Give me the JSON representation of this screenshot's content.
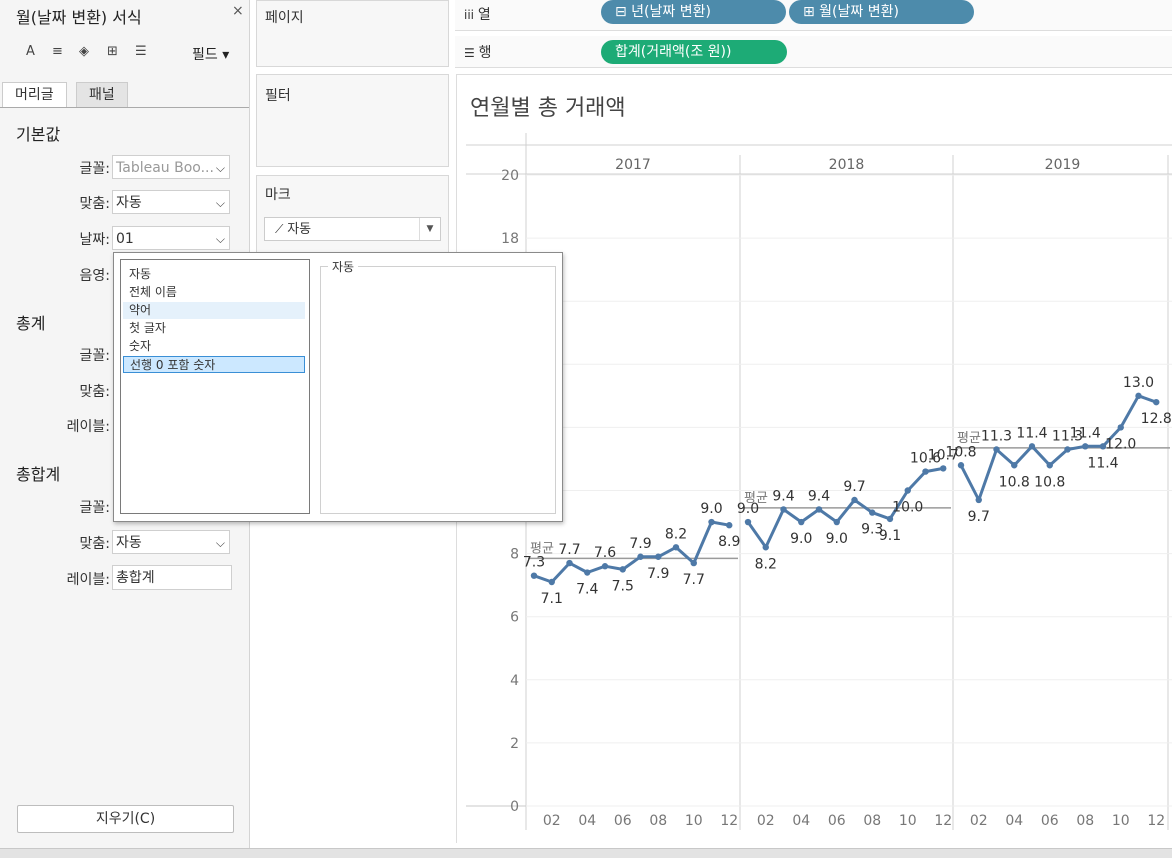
{
  "format_pane": {
    "title": "월(날짜 변환) 서식",
    "close_icon": "×",
    "toolbar": {
      "font_icon": "A",
      "align_icon": "≡",
      "shading_icon": "◈",
      "borders_icon": "⊞",
      "lines_icon": "☰",
      "fields_label": "필드 ▾"
    },
    "tabs": [
      "머리글",
      "패널"
    ],
    "default": {
      "heading": "기본값",
      "font_label": "글꼴:",
      "font_value": "Tableau Boo...",
      "align_label": "맞춤:",
      "align_value": "자동",
      "date_label": "날짜:",
      "date_value": "01",
      "shading_label": "음영:"
    },
    "totals": {
      "heading": "총계",
      "font_label": "글꼴:",
      "align_label": "맞춤:",
      "label_label": "레이블:"
    },
    "grand_totals": {
      "heading": "총합계",
      "font_label": "글꼴:",
      "align_label": "맞춤:",
      "align_value": "자동",
      "label_label": "레이블:",
      "label_value": "총합계"
    },
    "clear_button": "지우기(C)"
  },
  "shelves": {
    "pages": "페이지",
    "filters": "필터",
    "marks": "마크",
    "marks_type": "자동",
    "columns_label": "열",
    "rows_label": "행",
    "column_pills": [
      "⊟ 년(날짜 변환)",
      "⊞ 월(날짜 변환)"
    ],
    "row_pill": "합계(거래액(조 원))"
  },
  "popup": {
    "options": [
      "자동",
      "전체 이름",
      "약어",
      "첫 글자",
      "숫자",
      "선행 0 포함 숫자"
    ],
    "hover_index": 2,
    "selected_index": 5,
    "preview_label": "자동"
  },
  "colors": {
    "line": "#4e79a7",
    "pill_blue": "#4d8bab",
    "pill_green": "#1dab76",
    "popup_selected": "#cce8ff",
    "popup_hover": "#e5f1fb"
  },
  "chart_data": {
    "type": "line",
    "title": "연월별 총 거래액",
    "year_headers": [
      "2017",
      "2018",
      "2019"
    ],
    "month_ticks": [
      "02",
      "04",
      "06",
      "08",
      "10",
      "12"
    ],
    "y_ticks": [
      "0",
      "2",
      "4",
      "6",
      "8",
      "18",
      "20"
    ],
    "ylim": [
      0,
      20
    ],
    "reference_label": "평균",
    "series": [
      {
        "year": "2017",
        "values": [
          7.3,
          7.1,
          7.7,
          7.4,
          7.6,
          7.5,
          7.9,
          7.9,
          8.2,
          7.7,
          9.0,
          8.9
        ],
        "labels": [
          "7.3",
          "7.1",
          "7.7",
          "7.4",
          "7.6",
          "7.5",
          "7.9",
          "7.9",
          "8.2",
          "7.7",
          "9.0",
          "8.9"
        ],
        "average": 7.85
      },
      {
        "year": "2018",
        "values": [
          9.0,
          8.2,
          9.4,
          9.0,
          9.4,
          9.0,
          9.7,
          9.3,
          9.1,
          10.0,
          10.6,
          10.7
        ],
        "labels": [
          "9.0",
          "8.2",
          "9.4",
          "9.0",
          "9.4",
          "9.0",
          "9.7",
          "9.3",
          "9.1",
          "10.0",
          "10.6",
          "10.7"
        ],
        "average": 9.45
      },
      {
        "year": "2019",
        "values": [
          10.8,
          9.7,
          11.3,
          10.8,
          11.4,
          10.8,
          11.3,
          11.4,
          11.4,
          12.0,
          13.0,
          12.8
        ],
        "labels": [
          "10.8",
          "9.7",
          "11.3",
          "10.8",
          "11.4",
          "10.8",
          "11.3",
          "11.4",
          "11.4",
          "12.0",
          "13.0",
          "12.8"
        ],
        "average": 11.35
      }
    ]
  }
}
